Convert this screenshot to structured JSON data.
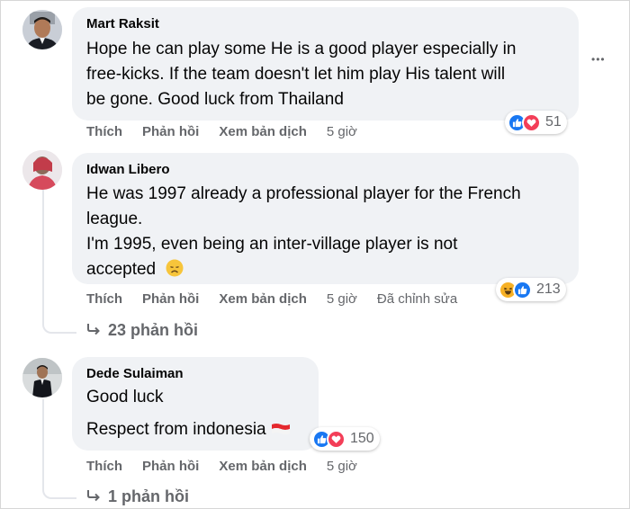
{
  "colors": {
    "bubble_bg": "#f0f2f5",
    "secondary_text": "#65676b",
    "like_blue": "#1877f2",
    "love_red": "#f33e58",
    "haha_yellow": "#f7b125"
  },
  "comments": [
    {
      "author": "Mart Raksit",
      "text": "Hope he can play some He is a good player especially in\nfree-kicks. If the team doesn't let him play His talent will\nbe gone. Good luck from Thailand",
      "reactions": [
        "like-icon",
        "love-icon"
      ],
      "reaction_count": "51",
      "actions": {
        "like": "Thích",
        "reply": "Phản hồi",
        "translate": "Xem bản dịch",
        "time": "5 giờ"
      },
      "more_label": "•••"
    },
    {
      "author": "Idwan Libero",
      "text": "He was 1997 already a professional player for the French\nleague.\nI'm 1995, even being an inter-village player is not\naccepted",
      "emoji": "disappointed-face-icon",
      "reactions": [
        "haha-icon",
        "like-icon"
      ],
      "reaction_count": "213",
      "actions": {
        "like": "Thích",
        "reply": "Phản hồi",
        "translate": "Xem bản dịch",
        "time": "5 giờ",
        "edited": "Đã chỉnh sửa"
      },
      "replies_label": "23 phản hồi"
    },
    {
      "author": "Dede Sulaiman",
      "text_line1": "Good luck",
      "text_line2": "Respect from indonesia",
      "emoji": "indonesia-flag-icon",
      "reactions": [
        "like-icon",
        "love-icon"
      ],
      "reaction_count": "150",
      "actions": {
        "like": "Thích",
        "reply": "Phản hồi",
        "translate": "Xem bản dịch",
        "time": "5 giờ"
      },
      "replies_label": "1 phản hồi"
    }
  ]
}
